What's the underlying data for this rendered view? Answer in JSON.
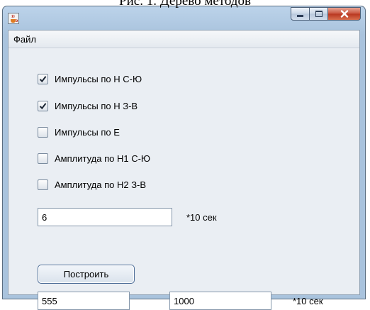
{
  "caption": "Рис. 1. Дерево методов",
  "window": {
    "icons": {
      "app": "java-cup-icon",
      "minimize": "minimize-icon",
      "maximize": "maximize-icon",
      "close": "close-icon"
    }
  },
  "menu": {
    "items": [
      {
        "label": "Файл"
      }
    ]
  },
  "checkboxes": [
    {
      "label": "Импульсы по Н С-Ю",
      "checked": true
    },
    {
      "label": "Импульсы по Н З-В",
      "checked": true
    },
    {
      "label": "Импульсы по Е",
      "checked": false
    },
    {
      "label": "Амплитуда по Н1 С-Ю",
      "checked": false
    },
    {
      "label": "Амплитуда по Н2 З-В",
      "checked": false
    }
  ],
  "period": {
    "value": "6",
    "unit": "*10 сек"
  },
  "build_button": {
    "label": "Построить"
  },
  "range": {
    "from": "555",
    "to": "1000",
    "unit": "*10 сек"
  },
  "colors": {
    "titlebar": "#a9c3dd",
    "panel": "#eaeef3",
    "close_button": "#c7503a",
    "button_border": "#4d6d97"
  }
}
